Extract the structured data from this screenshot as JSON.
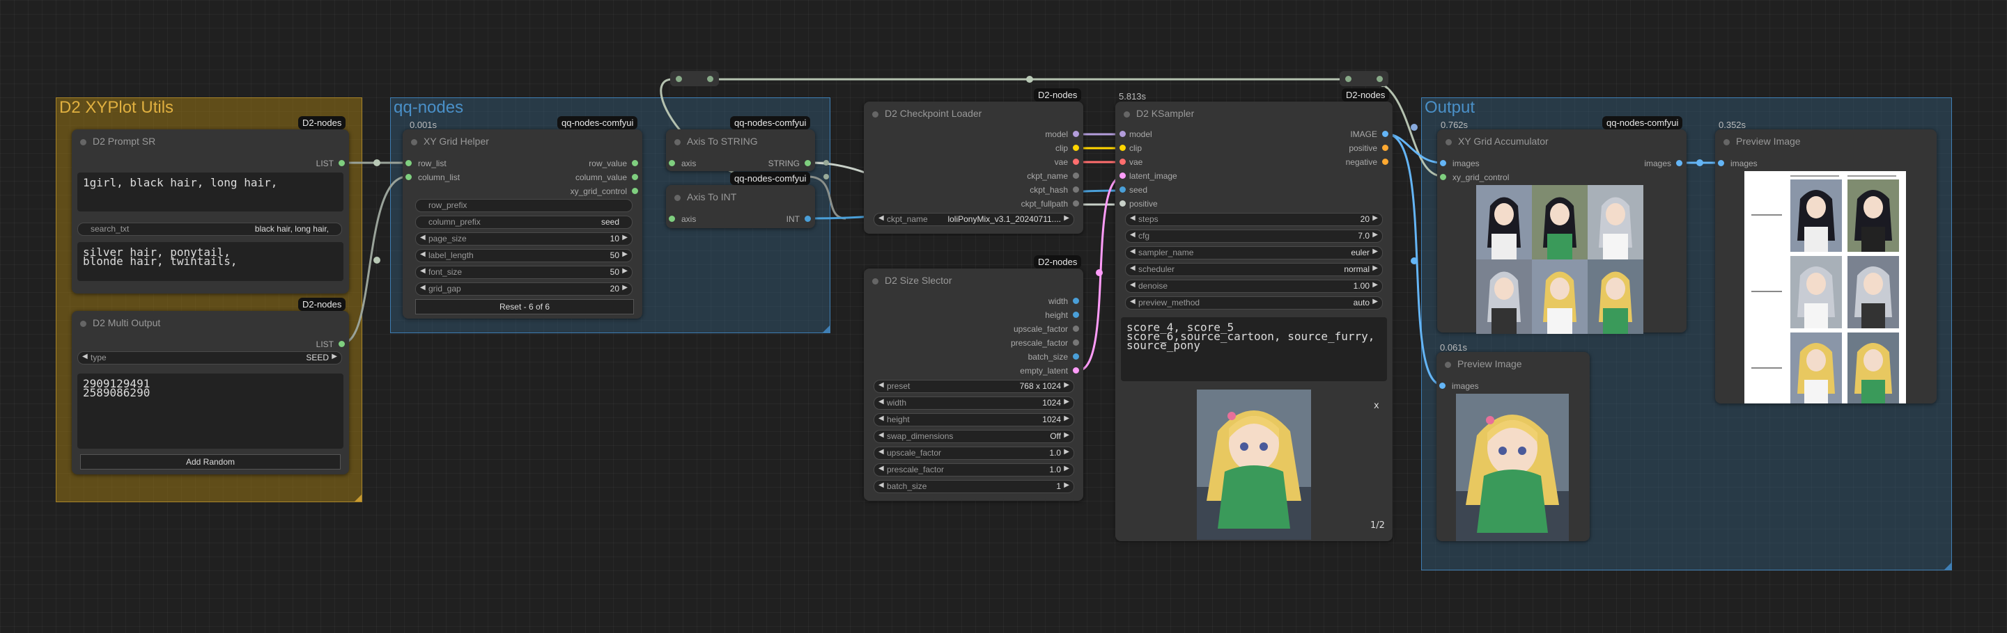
{
  "groups": {
    "xyplot": {
      "title": "D2 XYPlot Utils",
      "color": "#c8a030"
    },
    "qq": {
      "title": "qq-nodes",
      "color": "#3f7fb5"
    },
    "output": {
      "title": "Output",
      "color": "#3f7fb5"
    }
  },
  "badges": {
    "d2": "D2-nodes",
    "qq": "qq-nodes-comfyui"
  },
  "prompt_sr": {
    "title": "D2 Prompt SR",
    "out": "LIST",
    "text_top": "1girl, black hair, long hair,",
    "search_label": "search_txt",
    "search_value": "black hair, long hair,",
    "text_bottom": "silver hair, ponytail,\nblonde hair, twintails,"
  },
  "multi_output": {
    "title": "D2 Multi Output",
    "out": "LIST",
    "type_label": "type",
    "type_value": "SEED",
    "text": "2909129491\n2589086290",
    "button": "Add Random"
  },
  "xy_grid_helper": {
    "time": "0.001s",
    "title": "XY Grid Helper",
    "inputs": [
      "row_list",
      "column_list"
    ],
    "outputs": [
      "row_value",
      "column_value",
      "xy_grid_control"
    ],
    "text_row_prefix": "row_prefix",
    "text_column_prefix": "column_prefix",
    "text_column_prefix_value": "seed",
    "widgets": [
      {
        "label": "page_size",
        "value": "10"
      },
      {
        "label": "label_length",
        "value": "50"
      },
      {
        "label": "font_size",
        "value": "50"
      },
      {
        "label": "grid_gap",
        "value": "20"
      }
    ],
    "button": "Reset - 6 of 6"
  },
  "axis_to_string": {
    "title": "Axis To STRING",
    "in": "axis",
    "out": "STRING"
  },
  "axis_to_int": {
    "title": "Axis To INT",
    "in": "axis",
    "out": "INT"
  },
  "checkpoint_loader": {
    "title": "D2 Checkpoint Loader",
    "outputs": [
      "model",
      "clip",
      "vae",
      "ckpt_name",
      "ckpt_hash",
      "ckpt_fullpath"
    ],
    "ckpt_label": "ckpt_name",
    "ckpt_value": "loliPonyMix_v3.1_20240711...."
  },
  "size_selector": {
    "title": "D2 Size Slector",
    "outputs": [
      "width",
      "height",
      "upscale_factor",
      "prescale_factor",
      "batch_size",
      "empty_latent"
    ],
    "widgets": [
      {
        "label": "preset",
        "value": "768 x 1024"
      },
      {
        "label": "width",
        "value": "1024"
      },
      {
        "label": "height",
        "value": "1024"
      },
      {
        "label": "swap_dimensions",
        "value": "Off"
      },
      {
        "label": "upscale_factor",
        "value": "1.0"
      },
      {
        "label": "prescale_factor",
        "value": "1.0"
      },
      {
        "label": "batch_size",
        "value": "1"
      }
    ]
  },
  "ksampler": {
    "time": "5.813s",
    "title": "D2 KSampler",
    "inputs": [
      "model",
      "clip",
      "vae",
      "latent_image",
      "seed",
      "positive"
    ],
    "outputs": [
      "IMAGE",
      "positive",
      "negative"
    ],
    "widgets": [
      {
        "label": "steps",
        "value": "20"
      },
      {
        "label": "cfg",
        "value": "7.0"
      },
      {
        "label": "sampler_name",
        "value": "euler"
      },
      {
        "label": "scheduler",
        "value": "normal"
      },
      {
        "label": "denoise",
        "value": "1.00"
      },
      {
        "label": "preview_method",
        "value": "auto"
      }
    ],
    "prompt": "score_4, score_5\nscore_6,source_cartoon, source_furry,\nsource_pony",
    "close": "x",
    "counter": "1/2"
  },
  "xy_accumulator": {
    "time": "0.762s",
    "title": "XY Grid Accumulator",
    "inputs": [
      "images",
      "xy_grid_control"
    ],
    "out": "images"
  },
  "preview1": {
    "time": "0.352s",
    "title": "Preview Image",
    "in": "images"
  },
  "preview2": {
    "time": "0.061s",
    "title": "Preview Image",
    "in": "images"
  },
  "colors": {
    "model": "#b39ddb",
    "clip": "#ffd500",
    "vae": "#ff6e6e",
    "latent": "#ff9cf9",
    "image": "#64b5f6",
    "list": "#7fcf7f",
    "conditioning": "#ffa931"
  }
}
